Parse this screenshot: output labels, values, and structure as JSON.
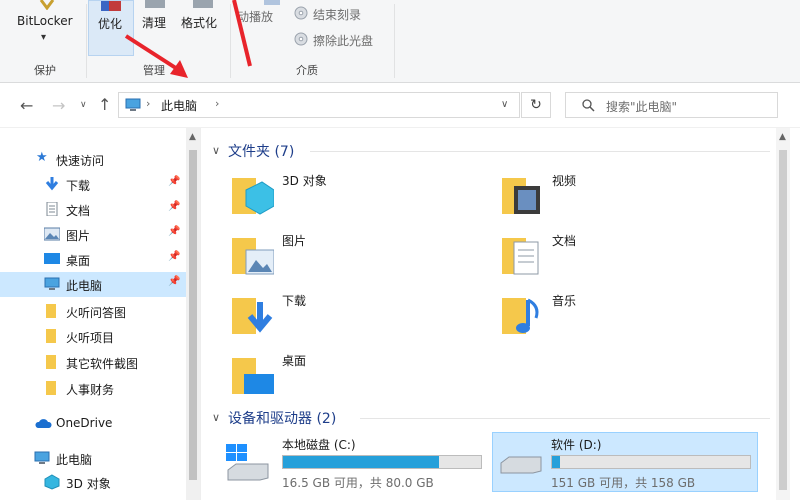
{
  "ribbon": {
    "groups": [
      {
        "label": "保护"
      },
      {
        "label": "管理"
      },
      {
        "label": "介质"
      }
    ],
    "buttons": {
      "bitlocker": "BitLocker",
      "bitlocker_arrow": "▾",
      "optimize": "优化",
      "cleanup": "清理",
      "format": "格式化",
      "autoplay": "动播放",
      "finish_burn": "结束刻录",
      "erase_disc": "擦除此光盘"
    }
  },
  "address": {
    "path_root": "此电脑",
    "search_placeholder": "搜索\"此电脑\""
  },
  "nav": {
    "quick_access": "快速访问",
    "items": [
      {
        "label": "下载"
      },
      {
        "label": "文档"
      },
      {
        "label": "图片"
      },
      {
        "label": "桌面"
      },
      {
        "label": "此电脑"
      },
      {
        "label": "火听问答图"
      },
      {
        "label": "火听项目"
      },
      {
        "label": "其它软件截图"
      },
      {
        "label": "人事财务"
      }
    ],
    "onedrive": "OneDrive",
    "this_pc": "此电脑",
    "objects_3d": "3D 对象"
  },
  "content": {
    "folders_header": "文件夹 (7)",
    "folders": [
      {
        "label": "3D 对象"
      },
      {
        "label": "视频"
      },
      {
        "label": "图片"
      },
      {
        "label": "文档"
      },
      {
        "label": "下载"
      },
      {
        "label": "音乐"
      },
      {
        "label": "桌面"
      }
    ],
    "drives_header": "设备和驱动器 (2)",
    "drives": [
      {
        "label": "本地磁盘 (C:)",
        "free": "16.5 GB 可用，共 80.0 GB",
        "used_fraction": 0.79
      },
      {
        "label": "软件 (D:)",
        "free": "151 GB 可用，共 158 GB",
        "used_fraction": 0.04
      }
    ]
  },
  "colors": {
    "accent": "#26a0da",
    "selection": "#cce8ff",
    "section_header": "#1e3e8a",
    "folder": "#f5c84b",
    "annotation_arrow": "#e8242b"
  }
}
